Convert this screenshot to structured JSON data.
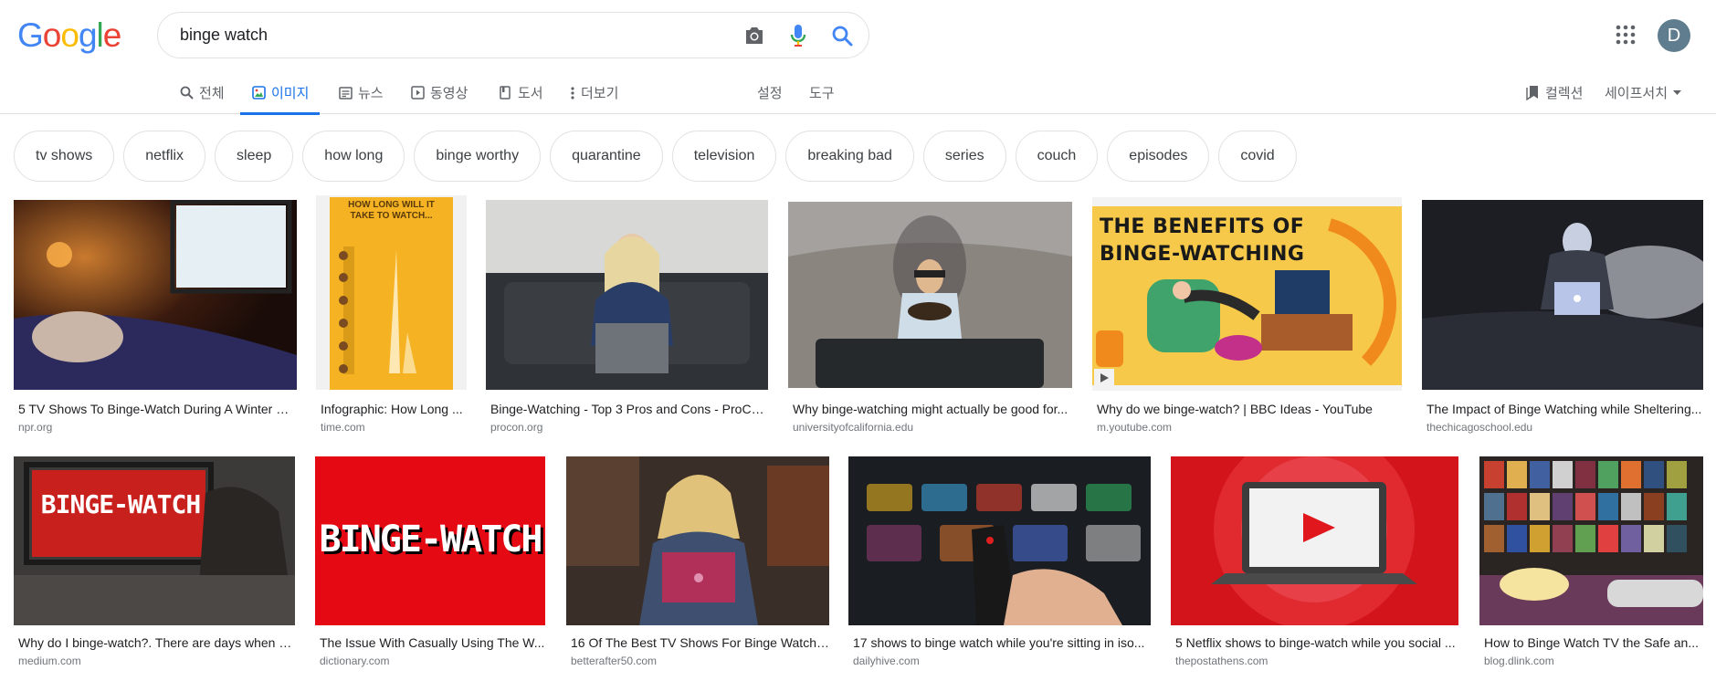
{
  "logo": {
    "letters": [
      "G",
      "o",
      "o",
      "g",
      "l",
      "e"
    ]
  },
  "search": {
    "query": "binge watch"
  },
  "avatar": {
    "initial": "D"
  },
  "tabs": {
    "all": "전체",
    "images": "이미지",
    "news": "뉴스",
    "videos": "동영상",
    "books": "도서",
    "more": "더보기",
    "settings": "설정",
    "tools": "도구",
    "collections": "컬렉션",
    "safesearch": "세이프서치"
  },
  "chips": [
    "tv shows",
    "netflix",
    "sleep",
    "how long",
    "binge worthy",
    "quarantine",
    "television",
    "breaking bad",
    "series",
    "couch",
    "episodes",
    "covid"
  ],
  "results": {
    "row1": [
      {
        "caption": "5 TV Shows To Binge-Watch During A Winter St...",
        "source": "npr.org"
      },
      {
        "caption": "Infographic: How Long ...",
        "source": "time.com",
        "overlay_title": "HOW LONG WILL IT TAKE TO WATCH..."
      },
      {
        "caption": "Binge-Watching - Top 3 Pros and Cons - ProCo...",
        "source": "procon.org"
      },
      {
        "caption": "Why binge-watching might actually be good for...",
        "source": "universityofcalifornia.edu"
      },
      {
        "caption": "Why do we binge-watch? | BBC Ideas - YouTube",
        "source": "m.youtube.com",
        "overlay_title_1": "THE BENEFITS OF",
        "overlay_title_2": "BINGE-WATCHING"
      },
      {
        "caption": "The Impact of Binge Watching while Sheltering...",
        "source": "thechicagoschool.edu"
      }
    ],
    "row2": [
      {
        "caption": "Why do I binge-watch?. There are days when m...",
        "source": "medium.com",
        "overlay_title": "BINGE-WATCH"
      },
      {
        "caption": "The Issue With Casually Using The W...",
        "source": "dictionary.com",
        "overlay_title": "BINGE-WATCH"
      },
      {
        "caption": "16 Of The Best TV Shows For Binge Watchi...",
        "source": "betterafter50.com"
      },
      {
        "caption": "17 shows to binge watch while you're sitting in iso...",
        "source": "dailyhive.com"
      },
      {
        "caption": "5 Netflix shows to binge-watch while you social ...",
        "source": "thepostathens.com"
      },
      {
        "caption": "How to Binge Watch TV the Safe an...",
        "source": "blog.dlink.com"
      }
    ]
  },
  "colors": {
    "accent": "#1a73e8",
    "netflix_red": "#e50914",
    "infographic_yellow": "#f5b324"
  }
}
